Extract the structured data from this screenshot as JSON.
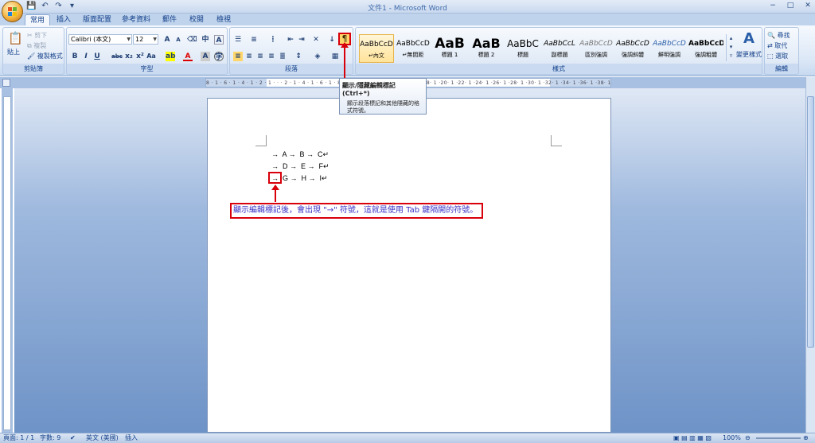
{
  "window": {
    "title": "文件1 - Microsoft Word"
  },
  "qat": {
    "save": "💾",
    "undo": "↶",
    "redo": "↷",
    "more": "▾"
  },
  "tabs": [
    "常用",
    "插入",
    "版面配置",
    "參考資料",
    "郵件",
    "校閱",
    "檢視"
  ],
  "clipboard": {
    "paste": "貼上",
    "cut": "剪下",
    "copy": "複製",
    "format_painter": "複製格式",
    "label": "剪貼簿"
  },
  "font": {
    "name": "Calibri (本文)",
    "size": "12",
    "label": "字型"
  },
  "paragraph": {
    "label": "段落",
    "show_marks_icon": "¶"
  },
  "styles": {
    "label": "樣式",
    "items": [
      {
        "sample": "AaBbCcD",
        "name": "↵內文"
      },
      {
        "sample": "AaBbCcD",
        "name": "↵無間距"
      },
      {
        "sample": "AaB",
        "name": "標題 1"
      },
      {
        "sample": "AaB",
        "name": "標題 2"
      },
      {
        "sample": "AaBbC",
        "name": "標題"
      },
      {
        "sample": "AaBbCcL",
        "name": "副標題"
      },
      {
        "sample": "AaBbCcD",
        "name": "區別強調"
      },
      {
        "sample": "AaBbCcD",
        "name": "強調斜體"
      },
      {
        "sample": "AaBbCcD",
        "name": "鮮明強調"
      },
      {
        "sample": "AaBbCcD",
        "name": "強調粗體"
      }
    ],
    "change_styles": "變更樣式"
  },
  "editing": {
    "find": "尋找",
    "replace": "取代",
    "select": "選取",
    "label": "編輯"
  },
  "tooltip": {
    "title": "顯示/隱藏編輯標記 (Ctrl+*)",
    "desc": "顯示段落標記和其他隱藏的格式符號。"
  },
  "ruler": {
    "numbers": "8 · 1 · 6 · 1 · 4 · 1 · 2 · 1 · · · 2 · 1 · 4 · 1 · 6 · 1 · 8 · 1 ·10· 1 ·12· 1 ·14· 1 ·16· 1 ·18· 1 ·20· 1 ·22· 1 ·24· 1 ·26· 1 ·28· 1 ·30· 1 ·32· 1 ·34· 1 ·36· 1 ·38· 1 ·40· 1 ·42"
  },
  "document": {
    "lines": [
      "→  A →  B →  C↵",
      "→  D →  E →  F↵",
      "→  G →  H →  I↵"
    ],
    "callout": "顯示編輯標記後，會出現 \"→\" 符號，這就是使用 Tab 鍵隔開的符號。"
  },
  "status": {
    "page": "頁面: 1 / 1",
    "words": "字數: 9",
    "lang": "英文 (美國)",
    "mode": "插入",
    "zoom": "100%"
  }
}
